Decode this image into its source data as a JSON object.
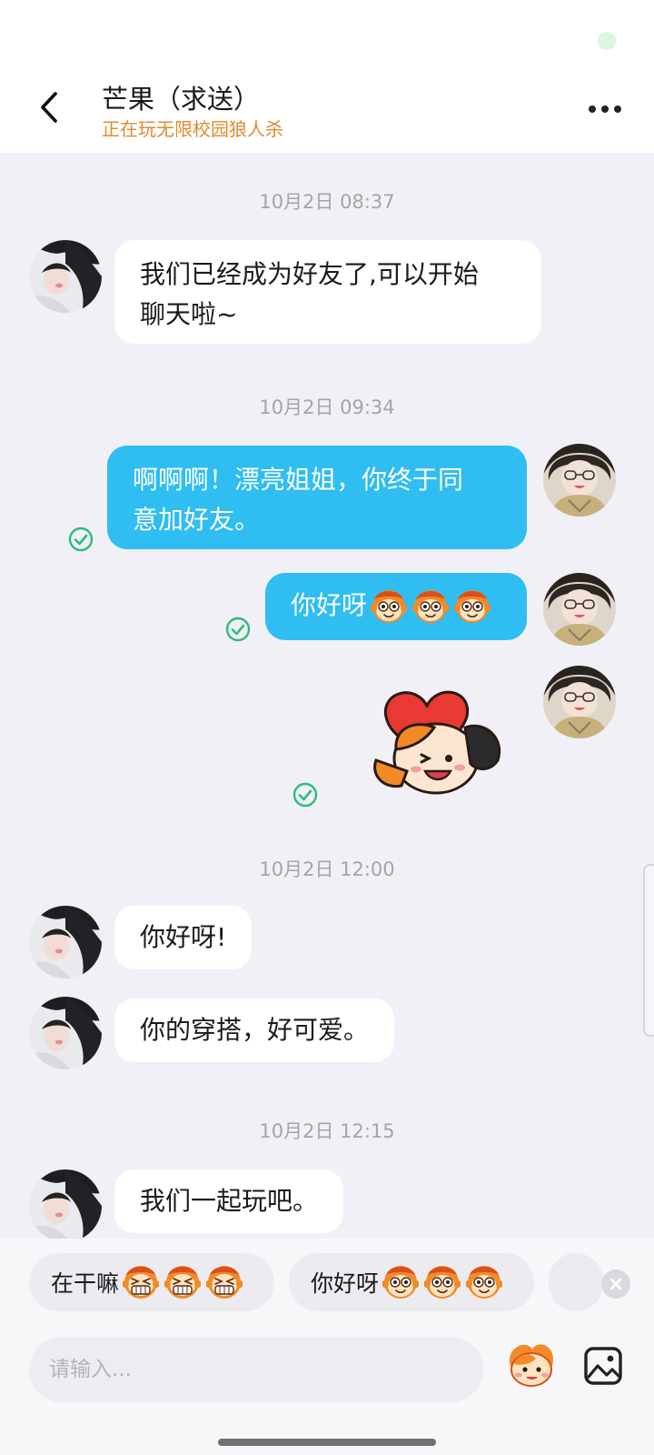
{
  "header": {
    "title": "芒果（求送）",
    "subtitle": "正在玩无限校园狼人杀"
  },
  "colors": {
    "accent_orange": "#e08a2c",
    "bubble_out": "#2fbdf2",
    "bubble_in": "#ffffff",
    "background": "#f0f0f6",
    "check_green": "#2dbd7a"
  },
  "messages": [
    {
      "time": "10月2日 08:37"
    },
    {
      "side": "in",
      "text_line1": "我们已经成为好友了,可以开始",
      "text_line2": "聊天啦~"
    },
    {
      "time": "10月2日 09:34"
    },
    {
      "side": "out",
      "text_line1": "啊啊啊！漂亮姐姐，你终于同",
      "text_line2": "意加好友。",
      "status": "read"
    },
    {
      "side": "out",
      "text": "你好呀",
      "emoji": "monkey-face-emoji",
      "emoji_count": 3,
      "status": "read"
    },
    {
      "side": "out",
      "type": "sticker",
      "sticker": "monkey-heart-sticker",
      "status": "read"
    },
    {
      "time": "10月2日 12:00"
    },
    {
      "side": "in",
      "text": "你好呀!"
    },
    {
      "side": "in",
      "text": "你的穿搭，好可爱。"
    },
    {
      "time": "10月2日 12:15"
    },
    {
      "side": "in",
      "text": "我们一起玩吧。"
    }
  ],
  "quick_replies": [
    {
      "text": "在干嘛",
      "emoji": "grin-monkey-emoji",
      "emoji_count": 3
    },
    {
      "text": "你好呀",
      "emoji": "monkey-face-emoji",
      "emoji_count": 3
    }
  ],
  "input": {
    "placeholder": "请输入..."
  }
}
